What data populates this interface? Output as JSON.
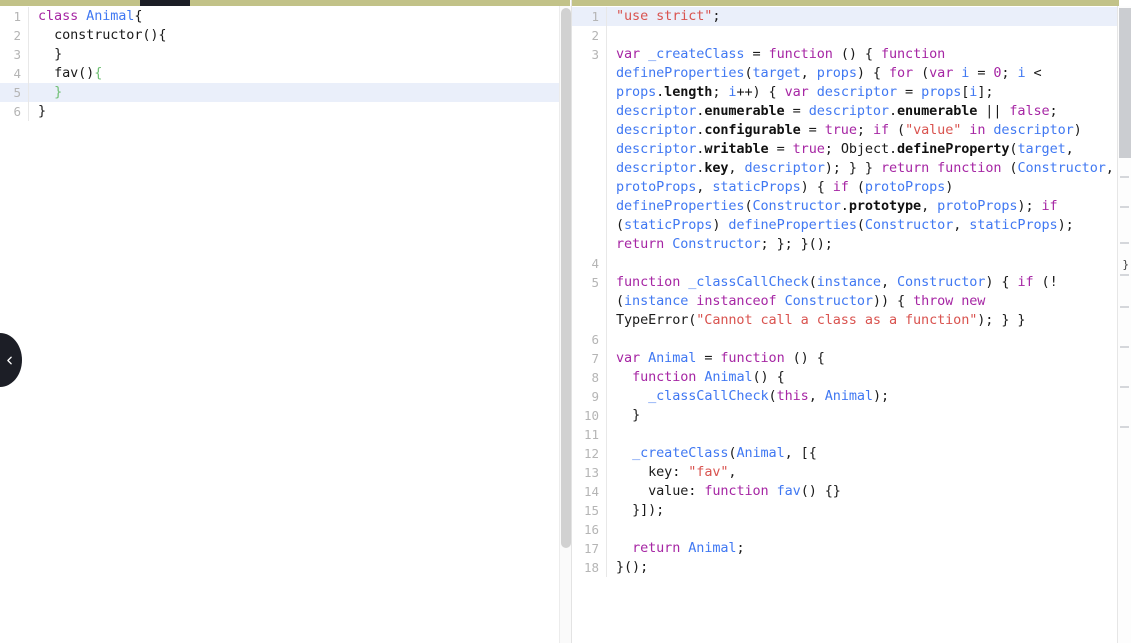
{
  "app": {
    "name": "babel-repl",
    "colors": {
      "keyword": "#a626a4",
      "definition": "#4078f2",
      "string": "#d9534f",
      "property": "#111111",
      "plain": "#1a1a1a",
      "active_line_bg": "#eaeffa",
      "scrollbar_top": "#8f8f26",
      "scrollbar_thumb_top": "#1c1e26",
      "collapse_button_bg": "#1c1e26"
    }
  },
  "sidebar_toggle": {
    "icon": "chevron-left-icon",
    "label": ""
  },
  "edge_marker": {
    "text": "}"
  },
  "left_editor": {
    "name": "source-editor",
    "active_line": 5,
    "lines": [
      {
        "num": "1",
        "tokens": [
          {
            "t": "class",
            "c": "t-kw"
          },
          {
            "t": " ",
            "c": "t-plain"
          },
          {
            "t": "Animal",
            "c": "t-def"
          },
          {
            "t": "{",
            "c": "t-plain"
          }
        ]
      },
      {
        "num": "2",
        "tokens": [
          {
            "t": "  constructor(){",
            "c": "t-plain"
          }
        ]
      },
      {
        "num": "3",
        "tokens": [
          {
            "t": "  }",
            "c": "t-plain"
          }
        ]
      },
      {
        "num": "4",
        "tokens": [
          {
            "t": "  fav()",
            "c": "t-plain"
          },
          {
            "t": "{",
            "c": "t-match"
          }
        ]
      },
      {
        "num": "5",
        "tokens": [
          {
            "t": "  ",
            "c": "t-plain"
          },
          {
            "t": "}",
            "c": "t-match"
          }
        ]
      },
      {
        "num": "6",
        "tokens": [
          {
            "t": "}",
            "c": "t-plain"
          }
        ]
      }
    ]
  },
  "right_editor": {
    "name": "compiled-output",
    "active_line": 1,
    "lines": [
      {
        "num": "1",
        "tokens": [
          {
            "t": "\"use strict\"",
            "c": "t-str"
          },
          {
            "t": ";",
            "c": "t-plain"
          }
        ]
      },
      {
        "num": "2",
        "tokens": []
      },
      {
        "num": "3",
        "tokens": [
          {
            "t": "var",
            "c": "t-kw"
          },
          {
            "t": " ",
            "c": "t-plain"
          },
          {
            "t": "_createClass",
            "c": "t-def"
          },
          {
            "t": " = ",
            "c": "t-plain"
          },
          {
            "t": "function",
            "c": "t-kw"
          },
          {
            "t": " () { ",
            "c": "t-plain"
          },
          {
            "t": "function",
            "c": "t-kw"
          },
          {
            "t": " ",
            "c": "t-plain"
          },
          {
            "t": "defineProperties",
            "c": "t-def"
          },
          {
            "t": "(",
            "c": "t-plain"
          },
          {
            "t": "target",
            "c": "t-def"
          },
          {
            "t": ", ",
            "c": "t-plain"
          },
          {
            "t": "props",
            "c": "t-def"
          },
          {
            "t": ") { ",
            "c": "t-plain"
          },
          {
            "t": "for",
            "c": "t-kw"
          },
          {
            "t": " (",
            "c": "t-plain"
          },
          {
            "t": "var",
            "c": "t-kw"
          },
          {
            "t": " ",
            "c": "t-plain"
          },
          {
            "t": "i",
            "c": "t-def"
          },
          {
            "t": " = ",
            "c": "t-plain"
          },
          {
            "t": "0",
            "c": "t-kw"
          },
          {
            "t": "; ",
            "c": "t-plain"
          },
          {
            "t": "i",
            "c": "t-def"
          },
          {
            "t": " < ",
            "c": "t-plain"
          },
          {
            "t": "props",
            "c": "t-def"
          },
          {
            "t": ".",
            "c": "t-plain"
          },
          {
            "t": "length",
            "c": "t-prop"
          },
          {
            "t": "; ",
            "c": "t-plain"
          },
          {
            "t": "i",
            "c": "t-def"
          },
          {
            "t": "++) { ",
            "c": "t-plain"
          },
          {
            "t": "var",
            "c": "t-kw"
          },
          {
            "t": " ",
            "c": "t-plain"
          },
          {
            "t": "descriptor",
            "c": "t-def"
          },
          {
            "t": " = ",
            "c": "t-plain"
          },
          {
            "t": "props",
            "c": "t-def"
          },
          {
            "t": "[",
            "c": "t-plain"
          },
          {
            "t": "i",
            "c": "t-def"
          },
          {
            "t": "]; ",
            "c": "t-plain"
          },
          {
            "t": "descriptor",
            "c": "t-def"
          },
          {
            "t": ".",
            "c": "t-plain"
          },
          {
            "t": "enumerable",
            "c": "t-prop"
          },
          {
            "t": " = ",
            "c": "t-plain"
          },
          {
            "t": "descriptor",
            "c": "t-def"
          },
          {
            "t": ".",
            "c": "t-plain"
          },
          {
            "t": "enumerable",
            "c": "t-prop"
          },
          {
            "t": " || ",
            "c": "t-plain"
          },
          {
            "t": "false",
            "c": "t-kw"
          },
          {
            "t": "; ",
            "c": "t-plain"
          },
          {
            "t": "descriptor",
            "c": "t-def"
          },
          {
            "t": ".",
            "c": "t-plain"
          },
          {
            "t": "configurable",
            "c": "t-prop"
          },
          {
            "t": " = ",
            "c": "t-plain"
          },
          {
            "t": "true",
            "c": "t-kw"
          },
          {
            "t": "; ",
            "c": "t-plain"
          },
          {
            "t": "if",
            "c": "t-kw"
          },
          {
            "t": " (",
            "c": "t-plain"
          },
          {
            "t": "\"value\"",
            "c": "t-str"
          },
          {
            "t": " ",
            "c": "t-plain"
          },
          {
            "t": "in",
            "c": "t-kw"
          },
          {
            "t": " ",
            "c": "t-plain"
          },
          {
            "t": "descriptor",
            "c": "t-def"
          },
          {
            "t": ") ",
            "c": "t-plain"
          },
          {
            "t": "descriptor",
            "c": "t-def"
          },
          {
            "t": ".",
            "c": "t-plain"
          },
          {
            "t": "writable",
            "c": "t-prop"
          },
          {
            "t": " = ",
            "c": "t-plain"
          },
          {
            "t": "true",
            "c": "t-kw"
          },
          {
            "t": "; ",
            "c": "t-plain"
          },
          {
            "t": "Object",
            "c": "t-plain"
          },
          {
            "t": ".",
            "c": "t-plain"
          },
          {
            "t": "defineProperty",
            "c": "t-prop"
          },
          {
            "t": "(",
            "c": "t-plain"
          },
          {
            "t": "target",
            "c": "t-def"
          },
          {
            "t": ", ",
            "c": "t-plain"
          },
          {
            "t": "descriptor",
            "c": "t-def"
          },
          {
            "t": ".",
            "c": "t-plain"
          },
          {
            "t": "key",
            "c": "t-prop"
          },
          {
            "t": ", ",
            "c": "t-plain"
          },
          {
            "t": "descriptor",
            "c": "t-def"
          },
          {
            "t": "); } } ",
            "c": "t-plain"
          },
          {
            "t": "return",
            "c": "t-kw"
          },
          {
            "t": " ",
            "c": "t-plain"
          },
          {
            "t": "function",
            "c": "t-kw"
          },
          {
            "t": " (",
            "c": "t-plain"
          },
          {
            "t": "Constructor",
            "c": "t-def"
          },
          {
            "t": ", ",
            "c": "t-plain"
          },
          {
            "t": "protoProps",
            "c": "t-def"
          },
          {
            "t": ", ",
            "c": "t-plain"
          },
          {
            "t": "staticProps",
            "c": "t-def"
          },
          {
            "t": ") { ",
            "c": "t-plain"
          },
          {
            "t": "if",
            "c": "t-kw"
          },
          {
            "t": " (",
            "c": "t-plain"
          },
          {
            "t": "protoProps",
            "c": "t-def"
          },
          {
            "t": ") ",
            "c": "t-plain"
          },
          {
            "t": "defineProperties",
            "c": "t-def"
          },
          {
            "t": "(",
            "c": "t-plain"
          },
          {
            "t": "Constructor",
            "c": "t-def"
          },
          {
            "t": ".",
            "c": "t-plain"
          },
          {
            "t": "prototype",
            "c": "t-prop"
          },
          {
            "t": ", ",
            "c": "t-plain"
          },
          {
            "t": "protoProps",
            "c": "t-def"
          },
          {
            "t": "); ",
            "c": "t-plain"
          },
          {
            "t": "if",
            "c": "t-kw"
          },
          {
            "t": " (",
            "c": "t-plain"
          },
          {
            "t": "staticProps",
            "c": "t-def"
          },
          {
            "t": ") ",
            "c": "t-plain"
          },
          {
            "t": "defineProperties",
            "c": "t-def"
          },
          {
            "t": "(",
            "c": "t-plain"
          },
          {
            "t": "Constructor",
            "c": "t-def"
          },
          {
            "t": ", ",
            "c": "t-plain"
          },
          {
            "t": "staticProps",
            "c": "t-def"
          },
          {
            "t": "); ",
            "c": "t-plain"
          },
          {
            "t": "return",
            "c": "t-kw"
          },
          {
            "t": " ",
            "c": "t-plain"
          },
          {
            "t": "Constructor",
            "c": "t-def"
          },
          {
            "t": "; }; }();",
            "c": "t-plain"
          }
        ]
      },
      {
        "num": "4",
        "tokens": []
      },
      {
        "num": "5",
        "tokens": [
          {
            "t": "function",
            "c": "t-kw"
          },
          {
            "t": " ",
            "c": "t-plain"
          },
          {
            "t": "_classCallCheck",
            "c": "t-def"
          },
          {
            "t": "(",
            "c": "t-plain"
          },
          {
            "t": "instance",
            "c": "t-def"
          },
          {
            "t": ", ",
            "c": "t-plain"
          },
          {
            "t": "Constructor",
            "c": "t-def"
          },
          {
            "t": ") { ",
            "c": "t-plain"
          },
          {
            "t": "if",
            "c": "t-kw"
          },
          {
            "t": " (!(",
            "c": "t-plain"
          },
          {
            "t": "instance",
            "c": "t-def"
          },
          {
            "t": " ",
            "c": "t-plain"
          },
          {
            "t": "instanceof",
            "c": "t-kw"
          },
          {
            "t": " ",
            "c": "t-plain"
          },
          {
            "t": "Constructor",
            "c": "t-def"
          },
          {
            "t": ")) { ",
            "c": "t-plain"
          },
          {
            "t": "throw",
            "c": "t-kw"
          },
          {
            "t": " ",
            "c": "t-plain"
          },
          {
            "t": "new",
            "c": "t-kw"
          },
          {
            "t": " ",
            "c": "t-plain"
          },
          {
            "t": "TypeError",
            "c": "t-plain"
          },
          {
            "t": "(",
            "c": "t-plain"
          },
          {
            "t": "\"Cannot call a class as a function\"",
            "c": "t-str"
          },
          {
            "t": "); } }",
            "c": "t-plain"
          }
        ]
      },
      {
        "num": "6",
        "tokens": []
      },
      {
        "num": "7",
        "tokens": [
          {
            "t": "var",
            "c": "t-kw"
          },
          {
            "t": " ",
            "c": "t-plain"
          },
          {
            "t": "Animal",
            "c": "t-def"
          },
          {
            "t": " = ",
            "c": "t-plain"
          },
          {
            "t": "function",
            "c": "t-kw"
          },
          {
            "t": " () {",
            "c": "t-plain"
          }
        ]
      },
      {
        "num": "8",
        "tokens": [
          {
            "t": "  ",
            "c": "t-plain"
          },
          {
            "t": "function",
            "c": "t-kw"
          },
          {
            "t": " ",
            "c": "t-plain"
          },
          {
            "t": "Animal",
            "c": "t-def"
          },
          {
            "t": "() {",
            "c": "t-plain"
          }
        ]
      },
      {
        "num": "9",
        "tokens": [
          {
            "t": "    ",
            "c": "t-plain"
          },
          {
            "t": "_classCallCheck",
            "c": "t-def"
          },
          {
            "t": "(",
            "c": "t-plain"
          },
          {
            "t": "this",
            "c": "t-kw"
          },
          {
            "t": ", ",
            "c": "t-plain"
          },
          {
            "t": "Animal",
            "c": "t-def"
          },
          {
            "t": ");",
            "c": "t-plain"
          }
        ]
      },
      {
        "num": "10",
        "tokens": [
          {
            "t": "  }",
            "c": "t-plain"
          }
        ]
      },
      {
        "num": "11",
        "tokens": []
      },
      {
        "num": "12",
        "tokens": [
          {
            "t": "  ",
            "c": "t-plain"
          },
          {
            "t": "_createClass",
            "c": "t-def"
          },
          {
            "t": "(",
            "c": "t-plain"
          },
          {
            "t": "Animal",
            "c": "t-def"
          },
          {
            "t": ", [{",
            "c": "t-plain"
          }
        ]
      },
      {
        "num": "13",
        "tokens": [
          {
            "t": "    key: ",
            "c": "t-plain"
          },
          {
            "t": "\"fav\"",
            "c": "t-str"
          },
          {
            "t": ",",
            "c": "t-plain"
          }
        ]
      },
      {
        "num": "14",
        "tokens": [
          {
            "t": "    value: ",
            "c": "t-plain"
          },
          {
            "t": "function",
            "c": "t-kw"
          },
          {
            "t": " ",
            "c": "t-plain"
          },
          {
            "t": "fav",
            "c": "t-def"
          },
          {
            "t": "() {}",
            "c": "t-plain"
          }
        ]
      },
      {
        "num": "15",
        "tokens": [
          {
            "t": "  }]);",
            "c": "t-plain"
          }
        ]
      },
      {
        "num": "16",
        "tokens": []
      },
      {
        "num": "17",
        "tokens": [
          {
            "t": "  ",
            "c": "t-plain"
          },
          {
            "t": "return",
            "c": "t-kw"
          },
          {
            "t": " ",
            "c": "t-plain"
          },
          {
            "t": "Animal",
            "c": "t-def"
          },
          {
            "t": ";",
            "c": "t-plain"
          }
        ]
      },
      {
        "num": "18",
        "tokens": [
          {
            "t": "}();",
            "c": "t-plain"
          }
        ]
      }
    ]
  }
}
